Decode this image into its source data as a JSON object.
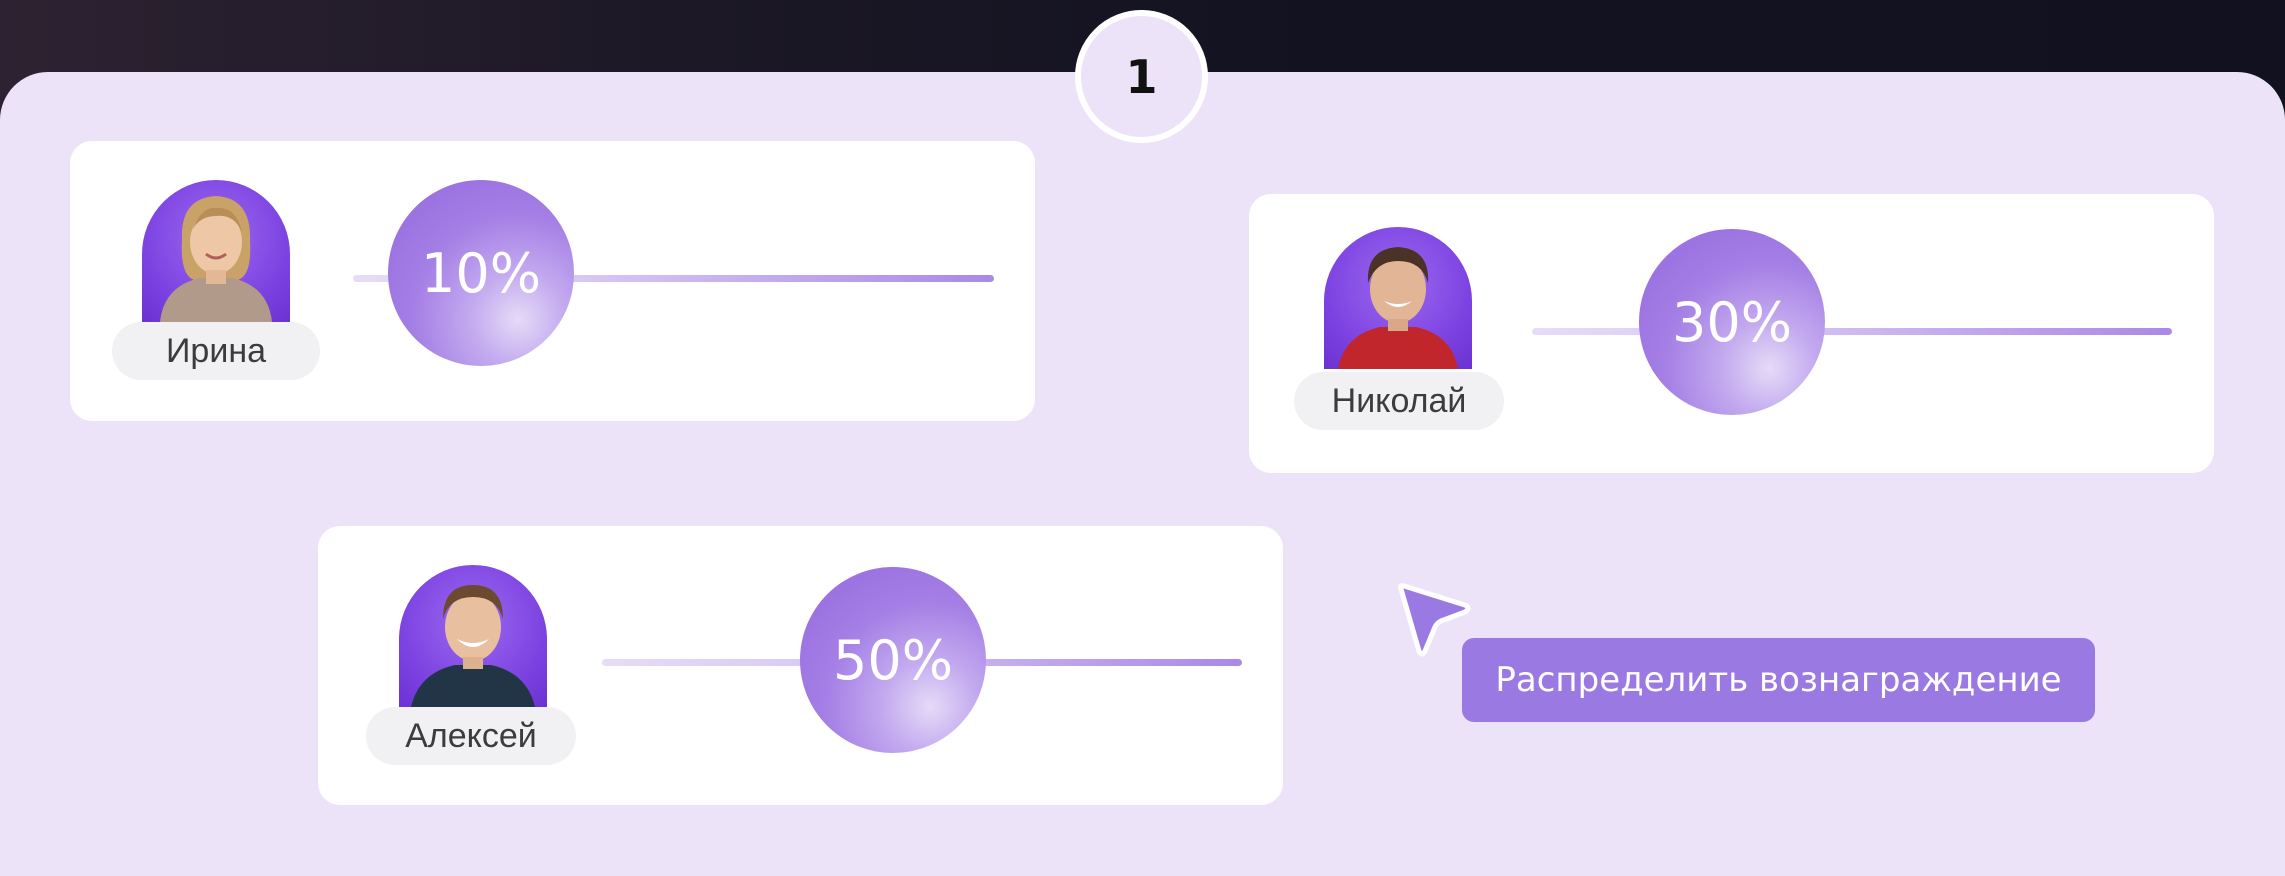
{
  "step": {
    "number": "1"
  },
  "participants": [
    {
      "name": "Ирина",
      "share": 10,
      "share_label": "10%"
    },
    {
      "name": "Николай",
      "share": 30,
      "share_label": "30%"
    },
    {
      "name": "Алексей",
      "share": 50,
      "share_label": "50%"
    }
  ],
  "action": {
    "label": "Распределить вознаграждение"
  },
  "colors": {
    "panel_bg": "#ece3f8",
    "accent": "#9b79e3",
    "avatar_bg": "#7a3fe0",
    "knob": "#a47fe5"
  },
  "icons": {
    "pointer": "cursor-arrow-icon"
  }
}
